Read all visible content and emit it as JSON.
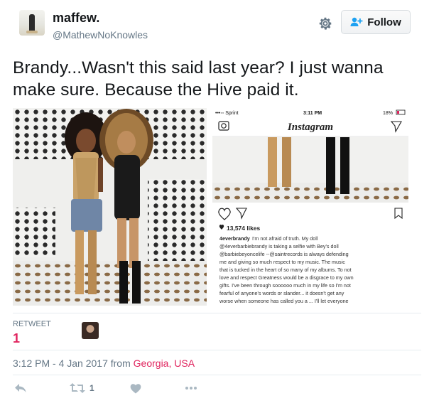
{
  "user": {
    "display_name": "maffew.",
    "handle": "@MathewNoKnowles",
    "follow_label": "Follow"
  },
  "tweet": {
    "text": "Brandy...Wasn't this said last year? I just wanna make sure. Because the Hive paid it."
  },
  "instagram": {
    "carrier": "•••◦◦ Sprint",
    "time": "3:11 PM",
    "battery": "18%",
    "logo": "Instagram",
    "likes": "13,574 likes",
    "username": "4everbrandy",
    "caption_lines": [
      "I'm not afraid of truth. My doll",
      "@4everbarbiebrandy is taking a selfie with Bey's doll",
      "@barbiebeyoncelife --@saintrecords is always defending",
      "me and giving so much respect to my music. The music",
      "that is tucked in the heart of so many of my albums. To not",
      "love and respect Greatness would be a disgrace to my own",
      "gifts. I've been through soooooo much in my life so I'm not",
      "fearful of anyone's words or slander... it doesn't get any",
      "worse when someone has called you a ... I'll let everyone"
    ]
  },
  "stats": {
    "retweet_label": "RETWEET",
    "retweet_count": "1"
  },
  "meta": {
    "timestamp": "3:12 PM - 4 Jan 2017 from",
    "location": "Georgia, USA"
  },
  "actions": {
    "retweet_count": "1"
  },
  "icons": {
    "gear": "gear-icon",
    "follow": "add-user-icon",
    "reply": "reply-icon",
    "retweet": "retweet-icon",
    "like": "heart-icon",
    "more": "more-icon"
  },
  "colors": {
    "accent": "#1da1f2",
    "location": "#e0245e",
    "secondary_text": "#657786"
  }
}
